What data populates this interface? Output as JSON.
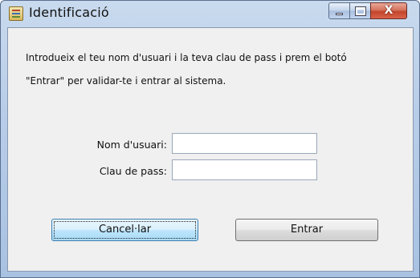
{
  "window": {
    "title": "Identificació",
    "controls": {
      "close_glyph": "X"
    },
    "icons": {
      "app": "java-app-icon",
      "minimize": "minimize-icon",
      "maximize": "maximize-icon",
      "close": "close-icon"
    }
  },
  "instructions": {
    "line1": "Introdueix el teu nom d'usuari i la teva clau de pass i prem el botó",
    "line2": "\"Entrar\" per validar-te i entrar al sistema."
  },
  "form": {
    "username_label": "Nom d'usuari:",
    "username_value": "",
    "password_label": "Clau de pass:",
    "password_value": ""
  },
  "buttons": {
    "cancel_label": "Cancel·lar",
    "enter_label": "Entrar",
    "focused": "cancel"
  },
  "colors": {
    "frame": "#b8cde8",
    "content_bg": "#f0f0f0",
    "close_button": "#c3452b",
    "focus_button": "#bee6fd"
  }
}
